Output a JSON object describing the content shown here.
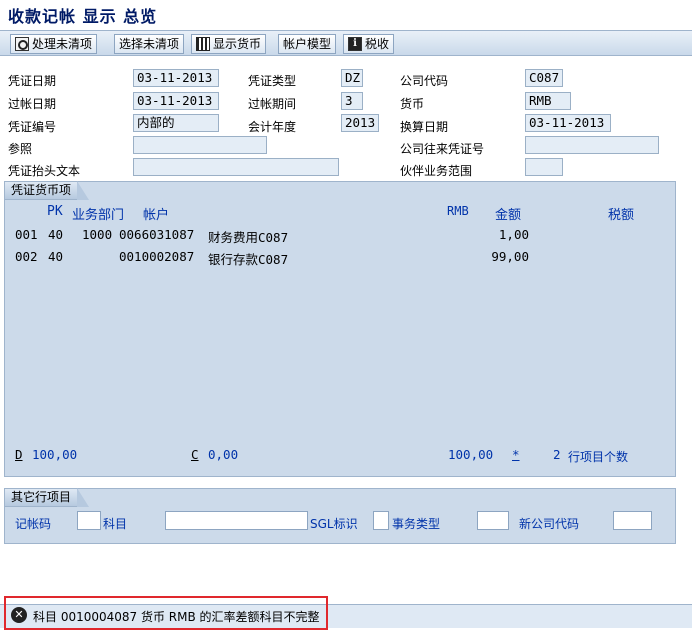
{
  "window": {
    "title": "收款记帐 显示 总览"
  },
  "toolbar": {
    "btn_open_items": "处理未清项",
    "btn_select_open": "选择未清项",
    "btn_show_currency": "显示货币",
    "btn_account_model": "帐户模型",
    "btn_tax": "税收"
  },
  "header": {
    "doc_date_label": "凭证日期",
    "doc_date": "03-11-2013",
    "doc_type_label": "凭证类型",
    "doc_type": "DZ",
    "company_code_label": "公司代码",
    "company_code": "C087",
    "posting_date_label": "过帐日期",
    "posting_date": "03-11-2013",
    "period_label": "过帐期间",
    "period": "3",
    "currency_label": "货币",
    "currency": "RMB",
    "doc_number_label": "凭证编号",
    "doc_number": "内部的",
    "fiscal_year_label": "会计年度",
    "fiscal_year": "2013",
    "translation_date_label": "换算日期",
    "translation_date": "03-11-2013",
    "reference_label": "参照",
    "reference": "",
    "intercompany_label": "公司往来凭证号",
    "intercompany": "",
    "header_text_label": "凭证抬头文本",
    "header_text": "",
    "partner_ba_label": "伙伴业务范围",
    "partner_ba": ""
  },
  "items_panel": {
    "tab_label": "凭证货币项",
    "col_pk": "PK",
    "col_ba": "业务部门",
    "col_account": "帐户",
    "col_currency": "RMB",
    "col_amount": "金额",
    "col_tax": "税额",
    "rows": [
      {
        "line": "001",
        "pk": "40",
        "ba": "1000",
        "account": "0066031087",
        "text": "财务费用C087",
        "amount": "1,00"
      },
      {
        "line": "002",
        "pk": "40",
        "ba": "",
        "account": "0010002087",
        "text": "银行存款C087",
        "amount": "99,00"
      }
    ],
    "debit_label": "D",
    "debit_value": "100,00",
    "credit_label": "C",
    "credit_value": "0,00",
    "balance_value": "100,00",
    "balance_marker": "*",
    "item_count": "2",
    "item_count_label": "行项目个数"
  },
  "other_panel": {
    "tab_label": "其它行项目",
    "posting_key_label": "记帐码",
    "account_label": "科目",
    "sgl_label": "SGL标识",
    "trans_type_label": "事务类型",
    "new_company_label": "新公司代码"
  },
  "status": {
    "message": "科目 0010004087 货币 RMB 的汇率差额科目不完整",
    "icon": "error-icon"
  },
  "colors": {
    "accent_blue": "#0033aa",
    "panel_bg": "#ccdaea",
    "error_box": "#e0282d"
  }
}
